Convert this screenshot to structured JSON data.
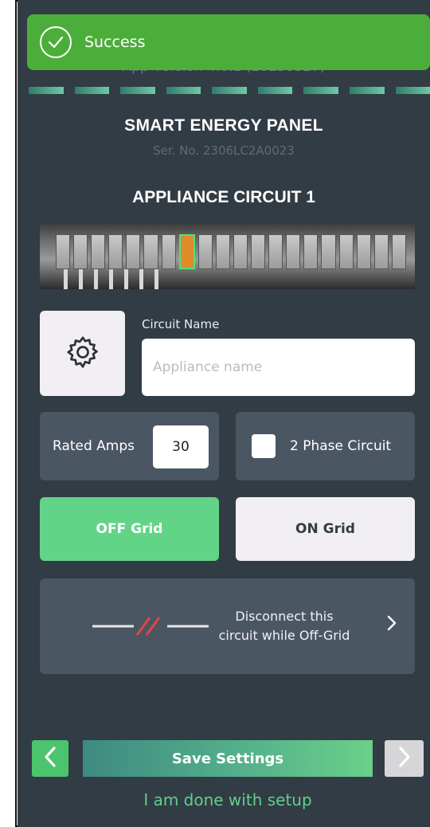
{
  "toast": {
    "text": "Success"
  },
  "app_version": "App Version 4.6.1 (20230327)",
  "progress": {
    "total_steps": 9,
    "completed_steps": 9
  },
  "panel": {
    "title": "SMART ENERGY PANEL",
    "serial": "Ser. No. 2306LC2A0023"
  },
  "circuit": {
    "title": "APPLIANCE CIRCUIT 1"
  },
  "settings": {
    "circuit_name_label": "Circuit Name",
    "circuit_name_placeholder": "Appliance name",
    "circuit_name_value": "",
    "rated_amps_label": "Rated Amps",
    "rated_amps_value": "30",
    "two_phase_label": "2 Phase Circuit",
    "two_phase_checked": false
  },
  "grid": {
    "off_label": "OFF Grid",
    "on_label": "ON Grid",
    "selected": "OFF Grid"
  },
  "disconnect": {
    "line1": "Disconnect this",
    "line2": "circuit while Off-Grid"
  },
  "footer": {
    "save_label": "Save Settings",
    "done_label": "I am done with setup"
  },
  "colors": {
    "background": "#323c45",
    "card": "#4b5663",
    "accent_green": "#62d487",
    "toast_green": "#4cae3a",
    "warning_red": "#e04646"
  }
}
